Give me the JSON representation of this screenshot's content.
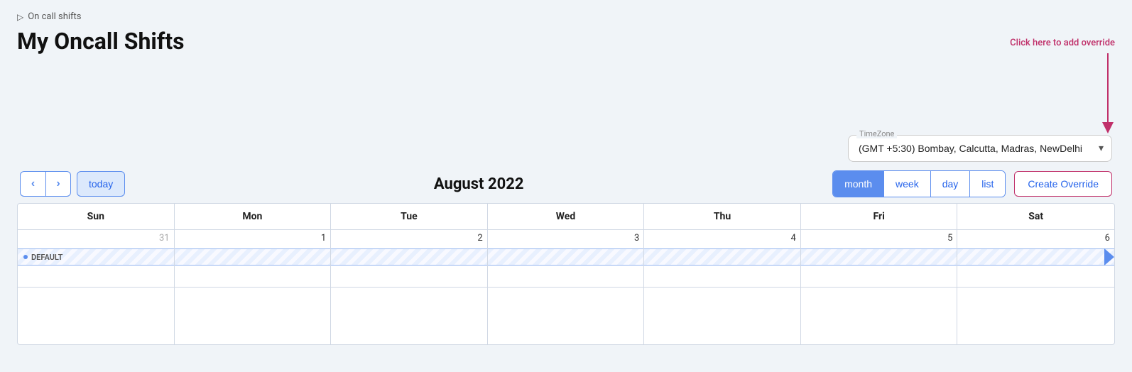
{
  "breadcrumb": {
    "icon": "▷",
    "label": "On call shifts"
  },
  "page": {
    "title": "My Oncall Shifts"
  },
  "hint": {
    "text": "Click here to add override"
  },
  "timezone": {
    "label": "TimeZone",
    "value": "(GMT +5:30) Bombay, Calcutta, Madras, NewDelhi"
  },
  "calendar": {
    "month_year": "August 2022",
    "nav": {
      "prev": "‹",
      "next": "›",
      "today": "today"
    },
    "views": [
      {
        "id": "month",
        "label": "month",
        "active": true
      },
      {
        "id": "week",
        "label": "week",
        "active": false
      },
      {
        "id": "day",
        "label": "day",
        "active": false
      },
      {
        "id": "list",
        "label": "list",
        "active": false
      }
    ],
    "create_override_label": "Create Override",
    "days": [
      "Sun",
      "Mon",
      "Tue",
      "Wed",
      "Thu",
      "Fri",
      "Sat"
    ],
    "cells": [
      {
        "num": "31",
        "current": false
      },
      {
        "num": "1",
        "current": true
      },
      {
        "num": "2",
        "current": true
      },
      {
        "num": "3",
        "current": true
      },
      {
        "num": "4",
        "current": true
      },
      {
        "num": "5",
        "current": true
      },
      {
        "num": "6",
        "current": true
      }
    ],
    "event_label": "DEFAULT"
  }
}
